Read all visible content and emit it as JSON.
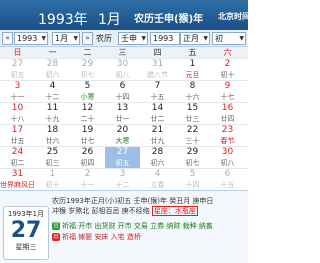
{
  "header": {
    "year": "1993年",
    "month": "1月",
    "lunar": "农历壬申(猴)年",
    "city": "北京时间"
  },
  "toolbar": {
    "year_select": "1993",
    "month_select": "1月",
    "lunar_label": "农历",
    "ganzhi_select": "壬申",
    "year_value": "1993",
    "lunar_month_select": "正月",
    "lunar_day_select": "初"
  },
  "weekdays": [
    "日",
    "一",
    "二",
    "三",
    "四",
    "五",
    "六"
  ],
  "weeks": [
    [
      {
        "n": "27",
        "l": "初五",
        "dim": true
      },
      {
        "n": "28",
        "l": "初六",
        "dim": true
      },
      {
        "n": "29",
        "l": "初七",
        "dim": true
      },
      {
        "n": "30",
        "l": "初八",
        "dim": true
      },
      {
        "n": "31",
        "l": "腊八节",
        "dim": true
      },
      {
        "n": "1",
        "l": "元旦",
        "fest": true
      },
      {
        "n": "2",
        "l": "初十"
      }
    ],
    [
      {
        "n": "3",
        "l": "十一"
      },
      {
        "n": "4",
        "l": "十二"
      },
      {
        "n": "5",
        "l": "小寒",
        "term": true
      },
      {
        "n": "6",
        "l": "十四"
      },
      {
        "n": "7",
        "l": "十五"
      },
      {
        "n": "8",
        "l": "十六"
      },
      {
        "n": "9",
        "l": "十七"
      }
    ],
    [
      {
        "n": "10",
        "l": "十八"
      },
      {
        "n": "11",
        "l": "十九"
      },
      {
        "n": "12",
        "l": "二十"
      },
      {
        "n": "13",
        "l": "廿一"
      },
      {
        "n": "14",
        "l": "廿二"
      },
      {
        "n": "15",
        "l": "廿三"
      },
      {
        "n": "16",
        "l": "廿四"
      }
    ],
    [
      {
        "n": "17",
        "l": "廿五"
      },
      {
        "n": "18",
        "l": "廿六"
      },
      {
        "n": "19",
        "l": "廿七"
      },
      {
        "n": "20",
        "l": "大寒",
        "term": true
      },
      {
        "n": "21",
        "l": "廿九"
      },
      {
        "n": "22",
        "l": "三十"
      },
      {
        "n": "23",
        "l": "春节",
        "fest": true
      }
    ],
    [
      {
        "n": "24",
        "l": "初二"
      },
      {
        "n": "25",
        "l": "初三"
      },
      {
        "n": "26",
        "l": "初四"
      },
      {
        "n": "27",
        "l": "初五",
        "sel": true
      },
      {
        "n": "28",
        "l": "初六"
      },
      {
        "n": "29",
        "l": "初七"
      },
      {
        "n": "30",
        "l": "初八"
      }
    ],
    [
      {
        "n": "31",
        "l": "世界麻风日",
        "fest": true
      },
      {
        "n": "1",
        "l": "初十",
        "dim": true
      },
      {
        "n": "2",
        "l": "十一",
        "dim": true
      },
      {
        "n": "3",
        "l": "十二",
        "dim": true
      },
      {
        "n": "4",
        "l": "立春",
        "dim": true
      },
      {
        "n": "5",
        "l": "十四",
        "dim": true
      },
      {
        "n": "6",
        "l": "十五",
        "dim": true
      }
    ]
  ],
  "bottom": {
    "ym": "1993年1月",
    "day": "27",
    "weekday": "星期三",
    "line1": "农历1993年正月(小)初五 壬申(猴)年 癸丑月 庚申日",
    "line2": "冲猴 岁煞北 彭祖百忌 庚不经络",
    "star": "星座：水瓶座",
    "yi_mark": "宜",
    "yi": "祈福 开市 出货财 开市 交易 立券 纳财 栽种 纳畜",
    "ji_mark": "忌",
    "ji": "祈福 嫁娶 安床 入宅 造桥"
  }
}
